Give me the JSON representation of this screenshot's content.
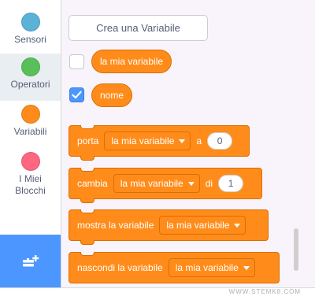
{
  "sidebar": {
    "categories": [
      {
        "label": "Sensori",
        "color": "#5cb1d6",
        "selected": false
      },
      {
        "label": "Operatori",
        "color": "#59c059",
        "selected": true
      },
      {
        "label": "Variabili",
        "color": "#ff8c1a",
        "selected": false
      },
      {
        "label": "I Miei Blocchi",
        "color": "#ff6680",
        "selected": false
      }
    ],
    "extension_icon": "add-extension-icon",
    "extension_color": "#4c97ff"
  },
  "palette": {
    "make_variable_label": "Crea una Variabile",
    "variables": [
      {
        "name": "la mia variabile",
        "checked": false
      },
      {
        "name": "nome",
        "checked": true
      }
    ],
    "blocks": {
      "set": {
        "verb": "porta",
        "dropdown": "la mia variabile",
        "prep": "a",
        "value": "0"
      },
      "change": {
        "verb": "cambia",
        "dropdown": "la mia variabile",
        "prep": "di",
        "value": "1"
      },
      "show": {
        "verb": "mostra la variabile",
        "dropdown": "la mia variabile"
      },
      "hide": {
        "verb": "nascondi la variabile",
        "dropdown": "la mia variabile"
      }
    },
    "block_color": "#ff8c1a",
    "block_border_color": "#db6e00"
  },
  "watermark": "WWW.STEMK8.COM"
}
